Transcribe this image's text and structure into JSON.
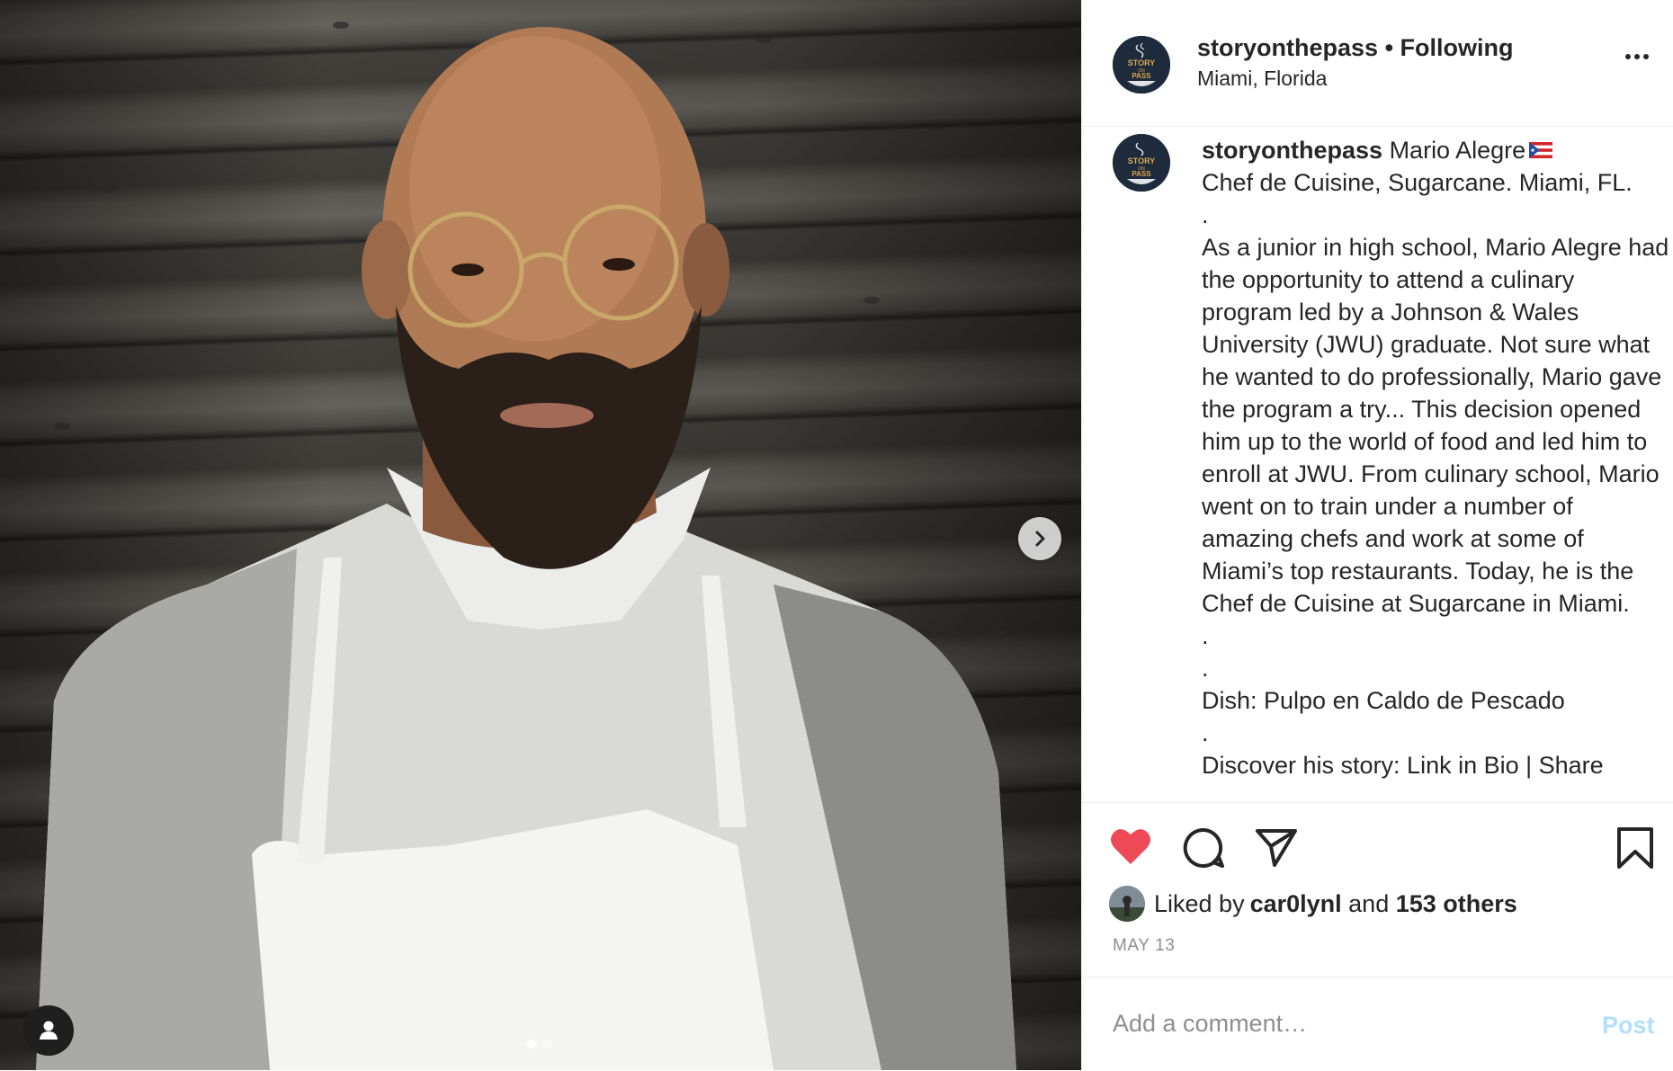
{
  "post": {
    "carousel_count": 2,
    "carousel_index": 1
  },
  "header": {
    "username": "storyonthepass",
    "separator": "•",
    "follow_status": "Following",
    "location": "Miami, Florida",
    "avatar_text_top": "STORY",
    "avatar_text_mid": "ON",
    "avatar_text_bottom": "PASS"
  },
  "caption": {
    "username": "storyonthepass",
    "text": " Mario Alegre",
    "flag_icon": "puerto-rico-flag-icon",
    "body": "Chef de Cuisine, Sugarcane. Miami, FL.\n.\nAs a junior in high school, Mario Alegre had the opportunity to attend a culinary program led by a Johnson & Wales University (JWU) graduate. Not sure what he wanted to do professionally, Mario gave the program a try... This decision opened him up to the world of food and led him to enroll at JWU. From culinary school, Mario went on to train under a number of amazing chefs and work at some of Miami’s top restaurants. Today, he is the Chef de Cuisine at Sugarcane in Miami.\n.\n.\nDish: Pulpo en Caldo de Pescado\n.\nDiscover his story: Link in Bio | Share"
  },
  "actions": {
    "liked_prefix": "Liked by ",
    "liked_user": "car0lynl",
    "liked_mid": " and ",
    "liked_count": "153 others",
    "date": "MAY 13"
  },
  "comment": {
    "placeholder": "Add a comment…",
    "post_label": "Post"
  },
  "colors": {
    "like_red": "#ed4956",
    "post_disabled": "#b2dffc",
    "avatar_navy": "#1d2b3d",
    "muted_text": "#8e8e8e"
  }
}
